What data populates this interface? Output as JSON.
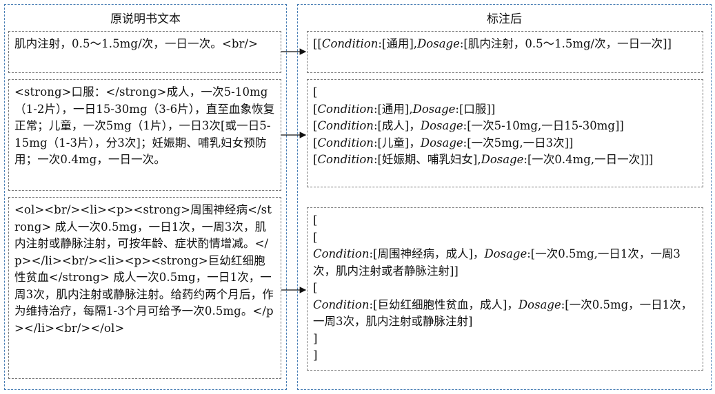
{
  "left_panel": {
    "title": "原说明书文本",
    "boxes": [
      {
        "text": "肌内注射，0.5～1.5mg/次，一日一次。<br/>"
      },
      {
        "text": "<strong>口服：</strong>成人，一次5-10mg（1-2片），一日15-30mg（3-6片），直至血象恢复正常；儿童，一次5mg（1片），一日3次[或一日5-15mg（1-3片），分3次]；妊娠期、哺乳妇女预防用；一次0.4mg，一日一次。"
      },
      {
        "text": "<ol><br/><li><p><strong>周围神经病</strong> 成人一次0.5mg，一日1次，一周3次，肌内注射或静脉注射，可按年龄、症状酌情增减。</p></li><br/><li><p><strong>巨幼红细胞性贫血</strong> 成人一次0.5mg，一日1次，一周3次，肌内注射或静脉注射。给药约两个月后，作为维持治疗，每隔1-3个月可给予一次0.5mg。</p></li><br/></ol>"
      }
    ]
  },
  "right_panel": {
    "title": "标注后",
    "keys": {
      "condition": "Condition",
      "dosage": "Dosage"
    },
    "box1": {
      "open": "[[",
      "cond": ":[通用],",
      "dose": ":[肌内注射，0.5～1.5mg/次，一日一次]]"
    },
    "box2": {
      "open": "[",
      "l1_cond": ":[通用],",
      "l1_dose": ":[口服]]",
      "l2_cond": ":[成人]，",
      "l2_dose": ":[一次5-10mg,一日15-30mg]]",
      "l3_cond": ":[儿童]，",
      "l3_dose": ":[一次5mg,一日3次]]",
      "l4_cond": ":[妊娠期、哺乳妇女],",
      "l4_dose": ":[一次0.4mg,一日一次]]]",
      "l_open": "["
    },
    "box3": {
      "open": "[",
      "l_open": "[",
      "l1_cond": ":[周围神经病，成人]，",
      "l1_dose": ":[一次0.5mg,一日1次，一周3次，肌内注射或者静脉注射]]",
      "l2_cond": ":[巨幼红细胞性贫血，成人]，",
      "l2_dose": ":[一次0.5mg，一日1次，一周3次，肌内注射或静脉注射]",
      "close": "]"
    }
  }
}
